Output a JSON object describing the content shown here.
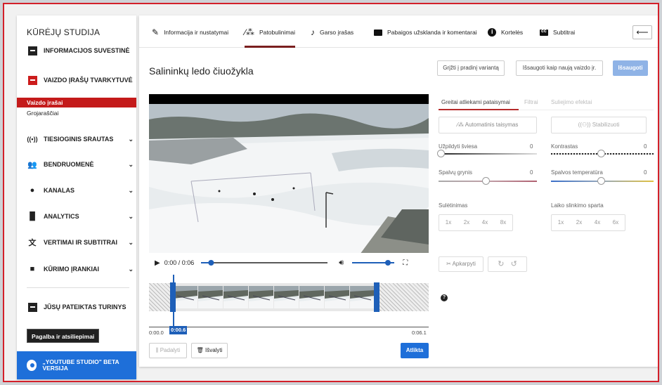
{
  "sidebar": {
    "title": "KŪRĖJŲ STUDIJA",
    "items": [
      {
        "label": "INFORMACIJOS SUVESTINĖ",
        "icon": "dashboard-icon"
      },
      {
        "label": "VAIZDO ĮRAŠŲ TVARKYTUVĖ",
        "icon": "video-manager-icon"
      },
      {
        "label": "TIESIOGINIS SRAUTAS",
        "icon": "live-icon"
      },
      {
        "label": "BENDRUOMENĖ",
        "icon": "community-icon"
      },
      {
        "label": "KANALAS",
        "icon": "channel-icon"
      },
      {
        "label": "ANALYTICS",
        "icon": "analytics-icon"
      },
      {
        "label": "VERTIMAI IR SUBTITRAI",
        "icon": "translate-icon"
      },
      {
        "label": "KŪRIMO ĮRANKIAI",
        "icon": "create-icon"
      },
      {
        "label": "JŪSŲ PATEIKTAS TURINYS",
        "icon": "contributions-icon"
      }
    ],
    "sub_items": [
      "Vaizdo įrašai",
      "Grojaraščiai"
    ],
    "help_label": "Pagalba ir atsiliepimai",
    "beta_label": "„YOUTUBE STUDIO\" BETA VERSIJA"
  },
  "tabs": [
    {
      "label": "Informacija ir nustatymai",
      "icon": "pencil-icon"
    },
    {
      "label": "Patobulinimai",
      "icon": "magic-wand-icon"
    },
    {
      "label": "Garso įrašas",
      "icon": "music-note-icon"
    },
    {
      "label": "Pabaigos užsklanda ir komentarai",
      "icon": "end-screen-icon"
    },
    {
      "label": "Kortelės",
      "icon": "info-card-icon"
    },
    {
      "label": "Subtitrai",
      "icon": "subtitles-icon"
    }
  ],
  "video_title": "Salininkų ledo čiuožykla",
  "actions": {
    "revert": "Grįžti į pradinį variantą",
    "save_new": "Išsaugoti kaip naują vaizdo įr.",
    "save": "Išsaugoti"
  },
  "player": {
    "time": "0:00 / 0:06",
    "progress": 0.08,
    "volume": 0.85
  },
  "timeline": {
    "start": "0:00.0",
    "current": "0:00.6",
    "end": "0:06.1",
    "split_label": "Padalyti",
    "clear_label": "Išvalyti",
    "done_label": "Atlikta"
  },
  "editor": {
    "tabs": [
      "Greitai atliekami pataisymai",
      "Filtrai",
      "Suliejimo efektai"
    ],
    "auto_fix": "Automatinis taisymas",
    "stabilize": "Stabilizuoti",
    "sliders": [
      {
        "label": "Užpildyti šviesa",
        "value": "0"
      },
      {
        "label": "Kontrastas",
        "value": "0"
      },
      {
        "label": "Spalvų grynis",
        "value": "0"
      },
      {
        "label": "Spalvos temperatūra",
        "value": "0"
      }
    ],
    "slow_label": "Sulėtinimas",
    "slow_options": [
      "1x",
      "2x",
      "4x",
      "8x"
    ],
    "timelapse_label": "Laiko slinkimo sparta",
    "timelapse_options": [
      "1x",
      "2x",
      "4x",
      "6x"
    ],
    "trim_label": "Apkarpyti"
  },
  "colors": {
    "accent_red": "#c41a1a",
    "accent_blue": "#1e6fd9"
  }
}
